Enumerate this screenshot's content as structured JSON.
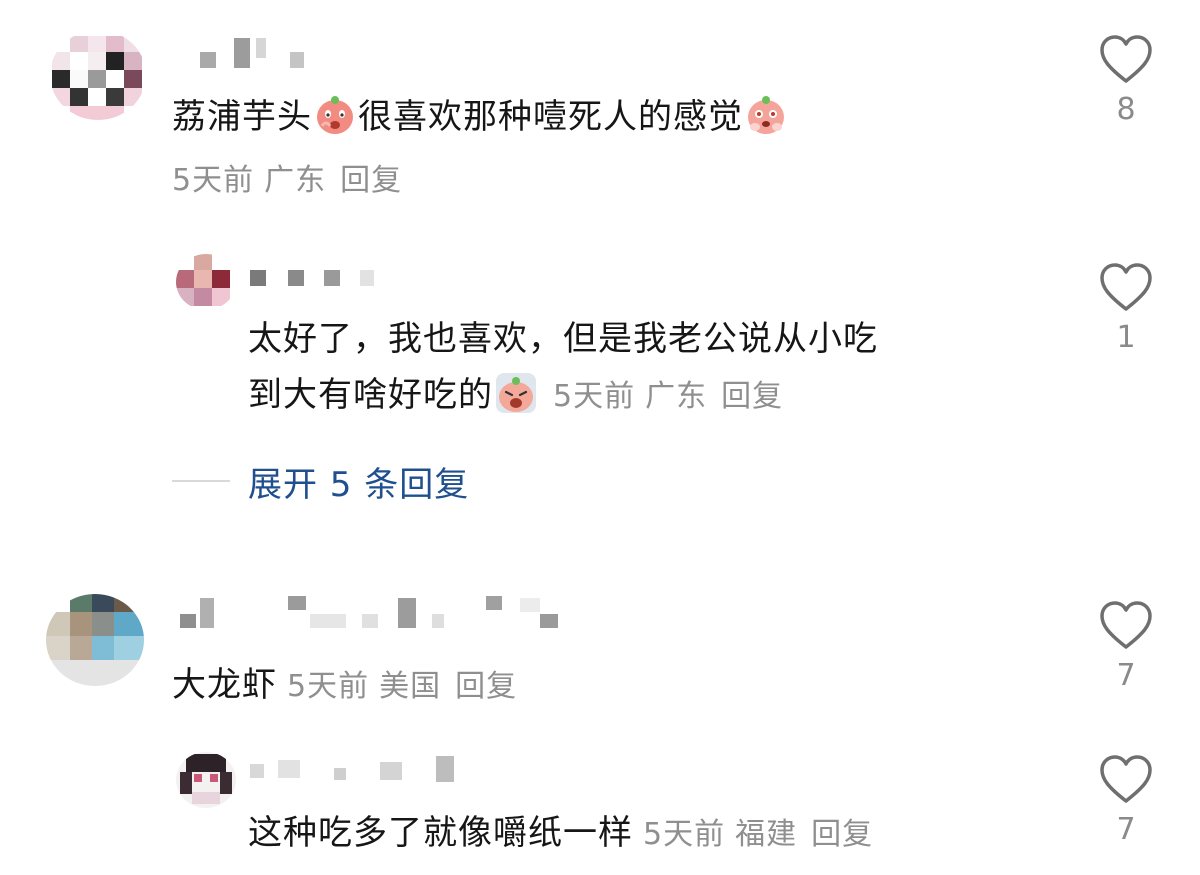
{
  "comments": [
    {
      "text": "荔浦芋头",
      "text2": "很喜欢那种噎死人的感觉",
      "emoji1": "angry-face-emoji",
      "emoji2": "shy-face-emoji",
      "time": "5天前",
      "region": "广东",
      "reply": "回复",
      "likes": "8",
      "replies": [
        {
          "line1": "太好了，我也喜欢，但是我老公说从小吃",
          "line2": "到大有啥好吃的",
          "emoji": "crying-face-emoji",
          "time": "5天前",
          "region": "广东",
          "reply": "回复",
          "likes": "1"
        }
      ],
      "expand_label": "展开 5 条回复"
    },
    {
      "text": "大龙虾",
      "time": "5天前",
      "region": "美国",
      "reply": "回复",
      "likes": "7",
      "replies": [
        {
          "text": "这种吃多了就像嚼纸一样",
          "time": "5天前",
          "region": "福建",
          "reply": "回复",
          "likes": "7"
        }
      ]
    }
  ],
  "colors": {
    "meta": "#8f8f8f",
    "expand": "#1f4f8f",
    "heart": "#6f6f6f"
  }
}
